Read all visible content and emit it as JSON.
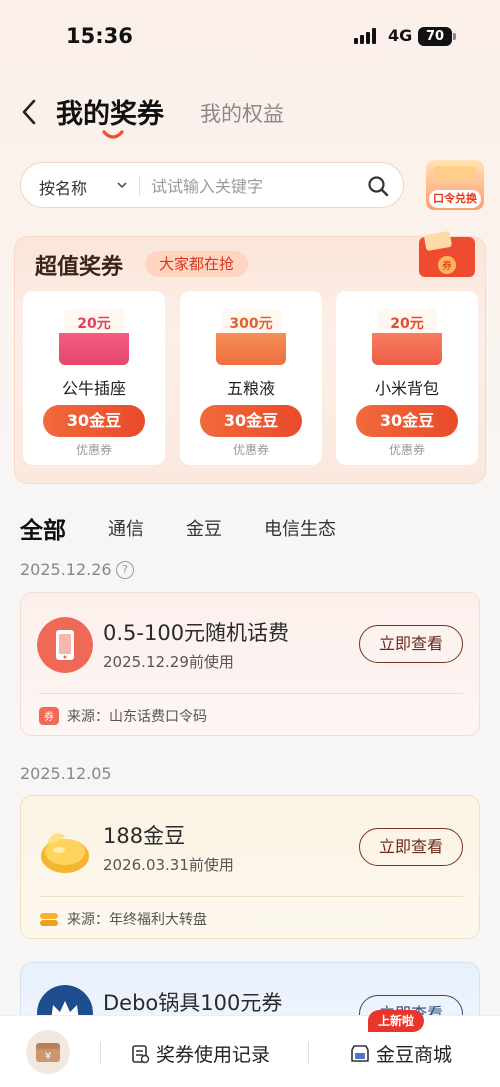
{
  "status_bar": {
    "time": "15:36",
    "network": "4G",
    "battery": "70"
  },
  "header": {
    "tab_active": "我的奖券",
    "tab_inactive": "我的权益"
  },
  "search": {
    "filter_label": "按名称",
    "placeholder": "试试输入关键字",
    "redeem_label": "口令兑换"
  },
  "super_coupons": {
    "title": "超值奖券",
    "tag": "大家都在抢",
    "items": [
      {
        "amount": "20元",
        "name": "公牛插座",
        "price": "30金豆",
        "type": "优惠券"
      },
      {
        "amount": "300元",
        "name": "五粮液",
        "price": "30金豆",
        "type": "优惠券"
      },
      {
        "amount": "20元",
        "name": "小米背包",
        "price": "30金豆",
        "type": "优惠券"
      }
    ]
  },
  "filter_tabs": [
    "全部",
    "通信",
    "金豆",
    "电信生态"
  ],
  "groups": [
    {
      "date": "2025.12.26",
      "coupon": {
        "title": "0.5-100元随机话费",
        "expiry": "2025.12.29前使用",
        "button": "立即查看",
        "source": "来源：山东话费口令码"
      }
    },
    {
      "date": "2025.12.05",
      "coupon": {
        "title": "188金豆",
        "expiry": "2026.03.31前使用",
        "button": "立即查看",
        "source": "来源：年终福利大转盘"
      }
    }
  ],
  "partial_coupon": {
    "title": "Debo锅具100元券",
    "button": "立即查看"
  },
  "bottom_bar": {
    "records_label": "奖券使用记录",
    "mall_label": "金豆商城",
    "mall_badge": "上新啦"
  },
  "colors": {
    "accent": "#e9472a",
    "brand_dark": "#6b2a1d",
    "background": "#f7f6f5"
  }
}
